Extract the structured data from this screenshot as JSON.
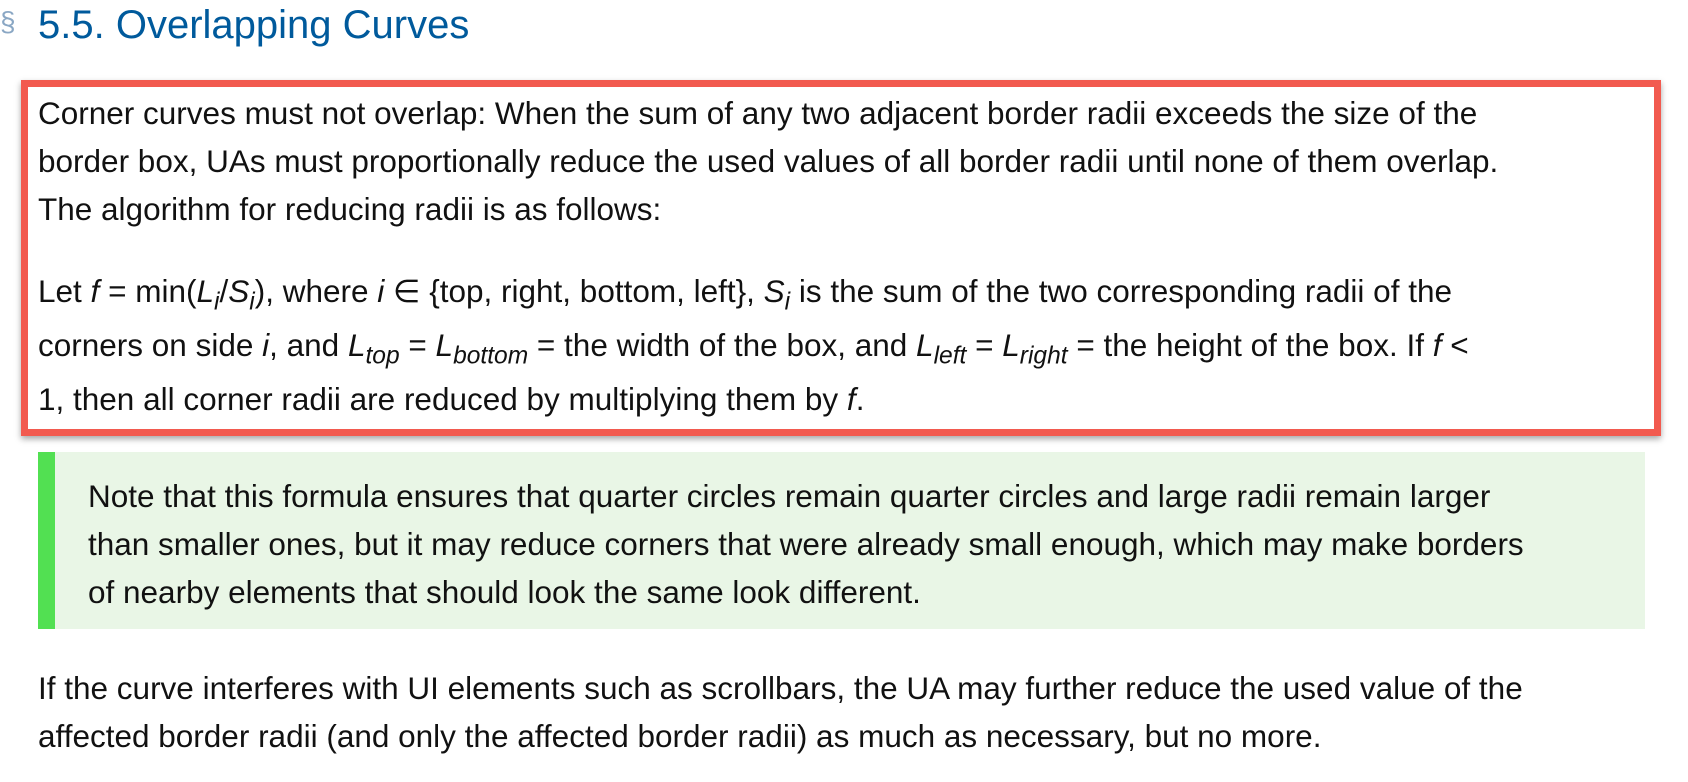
{
  "section": {
    "mark": "§",
    "title": "5.5. Overlapping Curves"
  },
  "paragraph1": {
    "lines": [
      "Corner curves must not overlap: When the sum of any two adjacent border radii exceeds the size of the",
      "border box, UAs must proportionally reduce the used values of all border radii until none of them overlap.",
      "The algorithm for reducing radii is as follows:"
    ]
  },
  "formula": {
    "line1": {
      "t1": "Let ",
      "f": "f",
      "t2": " = min(",
      "L": "L",
      "i_sub1": "i",
      "slash": "/",
      "S": "S",
      "i_sub2": "i",
      "t3": "), where ",
      "i": "i",
      "t4": " ∈ {top, right, bottom, left}, ",
      "S2": "S",
      "i_sub3": "i",
      "t5": " is the sum of the two corresponding radii of the"
    },
    "line2": {
      "t1": "corners on side ",
      "i": "i",
      "t2": ", and ",
      "L1": "L",
      "sub_top": "top",
      "t3": " = ",
      "L2": "L",
      "sub_bottom": "bottom",
      "t4": " = the width of the box, and ",
      "L3": "L",
      "sub_left": "left",
      "t5": " = ",
      "L4": "L",
      "sub_right": "right",
      "t6": " = the height of the box. If ",
      "f": "f",
      "t7": " <"
    },
    "line3": {
      "t1": "1, then all corner radii are reduced by multiplying them by ",
      "f": "f",
      "t2": "."
    }
  },
  "note": {
    "lines": [
      "Note that this formula ensures that quarter circles remain quarter circles and large radii remain larger",
      "than smaller ones, but it may reduce corners that were already small enough, which may make borders",
      "of nearby elements that should look the same look different."
    ]
  },
  "paragraph3": {
    "lines": [
      "If the curve interferes with UI elements such as scrollbars, the UA may further reduce the used value of the",
      "affected border radii (and only the affected border radii) as much as necessary, but no more."
    ]
  },
  "colors": {
    "heading": "#005a9c",
    "highlight_border": "#f25a4f",
    "note_background": "#e9f6e6",
    "note_border": "#52e052"
  }
}
